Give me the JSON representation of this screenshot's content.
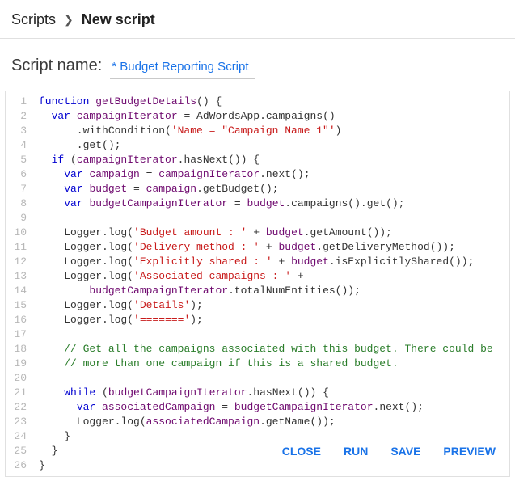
{
  "breadcrumb": {
    "root": "Scripts",
    "current": "New script"
  },
  "name_field": {
    "label": "Script name:",
    "value": "* Budget Reporting Script"
  },
  "actions": {
    "close": "CLOSE",
    "run": "RUN",
    "save": "SAVE",
    "preview": "PREVIEW"
  },
  "editor": {
    "lines": [
      [
        [
          "kw",
          "function"
        ],
        [
          "ord",
          " "
        ],
        [
          "fn",
          "getBudgetDetails"
        ],
        [
          "ord",
          "() {"
        ]
      ],
      [
        [
          "ord",
          "  "
        ],
        [
          "kw",
          "var"
        ],
        [
          "ord",
          " "
        ],
        [
          "name",
          "campaignIterator"
        ],
        [
          "ord",
          " = AdWordsApp.campaigns()"
        ]
      ],
      [
        [
          "ord",
          "      .withCondition("
        ],
        [
          "str",
          "'Name = \"Campaign Name 1\"'"
        ],
        [
          "ord",
          ")"
        ]
      ],
      [
        [
          "ord",
          "      .get();"
        ]
      ],
      [
        [
          "ord",
          "  "
        ],
        [
          "kw",
          "if"
        ],
        [
          "ord",
          " ("
        ],
        [
          "name",
          "campaignIterator"
        ],
        [
          "ord",
          ".hasNext()) {"
        ]
      ],
      [
        [
          "ord",
          "    "
        ],
        [
          "kw",
          "var"
        ],
        [
          "ord",
          " "
        ],
        [
          "name",
          "campaign"
        ],
        [
          "ord",
          " = "
        ],
        [
          "name",
          "campaignIterator"
        ],
        [
          "ord",
          ".next();"
        ]
      ],
      [
        [
          "ord",
          "    "
        ],
        [
          "kw",
          "var"
        ],
        [
          "ord",
          " "
        ],
        [
          "name",
          "budget"
        ],
        [
          "ord",
          " = "
        ],
        [
          "name",
          "campaign"
        ],
        [
          "ord",
          ".getBudget();"
        ]
      ],
      [
        [
          "ord",
          "    "
        ],
        [
          "kw",
          "var"
        ],
        [
          "ord",
          " "
        ],
        [
          "name",
          "budgetCampaignIterator"
        ],
        [
          "ord",
          " = "
        ],
        [
          "name",
          "budget"
        ],
        [
          "ord",
          ".campaigns().get();"
        ]
      ],
      [
        [
          "ord",
          ""
        ]
      ],
      [
        [
          "ord",
          "    Logger.log("
        ],
        [
          "str",
          "'Budget amount : '"
        ],
        [
          "ord",
          " + "
        ],
        [
          "name",
          "budget"
        ],
        [
          "ord",
          ".getAmount());"
        ]
      ],
      [
        [
          "ord",
          "    Logger.log("
        ],
        [
          "str",
          "'Delivery method : '"
        ],
        [
          "ord",
          " + "
        ],
        [
          "name",
          "budget"
        ],
        [
          "ord",
          ".getDeliveryMethod());"
        ]
      ],
      [
        [
          "ord",
          "    Logger.log("
        ],
        [
          "str",
          "'Explicitly shared : '"
        ],
        [
          "ord",
          " + "
        ],
        [
          "name",
          "budget"
        ],
        [
          "ord",
          ".isExplicitlyShared());"
        ]
      ],
      [
        [
          "ord",
          "    Logger.log("
        ],
        [
          "str",
          "'Associated campaigns : '"
        ],
        [
          "ord",
          " +"
        ]
      ],
      [
        [
          "ord",
          "        "
        ],
        [
          "name",
          "budgetCampaignIterator"
        ],
        [
          "ord",
          ".totalNumEntities());"
        ]
      ],
      [
        [
          "ord",
          "    Logger.log("
        ],
        [
          "str",
          "'Details'"
        ],
        [
          "ord",
          ");"
        ]
      ],
      [
        [
          "ord",
          "    Logger.log("
        ],
        [
          "str",
          "'======='"
        ],
        [
          "ord",
          ");"
        ]
      ],
      [
        [
          "ord",
          ""
        ]
      ],
      [
        [
          "ord",
          "    "
        ],
        [
          "com",
          "// Get all the campaigns associated with this budget. There could be"
        ]
      ],
      [
        [
          "ord",
          "    "
        ],
        [
          "com",
          "// more than one campaign if this is a shared budget."
        ]
      ],
      [
        [
          "ord",
          ""
        ]
      ],
      [
        [
          "ord",
          "    "
        ],
        [
          "kw",
          "while"
        ],
        [
          "ord",
          " ("
        ],
        [
          "name",
          "budgetCampaignIterator"
        ],
        [
          "ord",
          ".hasNext()) {"
        ]
      ],
      [
        [
          "ord",
          "      "
        ],
        [
          "kw",
          "var"
        ],
        [
          "ord",
          " "
        ],
        [
          "name",
          "associatedCampaign"
        ],
        [
          "ord",
          " = "
        ],
        [
          "name",
          "budgetCampaignIterator"
        ],
        [
          "ord",
          ".next();"
        ]
      ],
      [
        [
          "ord",
          "      Logger.log("
        ],
        [
          "name",
          "associatedCampaign"
        ],
        [
          "ord",
          ".getName());"
        ]
      ],
      [
        [
          "ord",
          "    }"
        ]
      ],
      [
        [
          "ord",
          "  }"
        ]
      ],
      [
        [
          "ord",
          "}"
        ]
      ]
    ]
  }
}
